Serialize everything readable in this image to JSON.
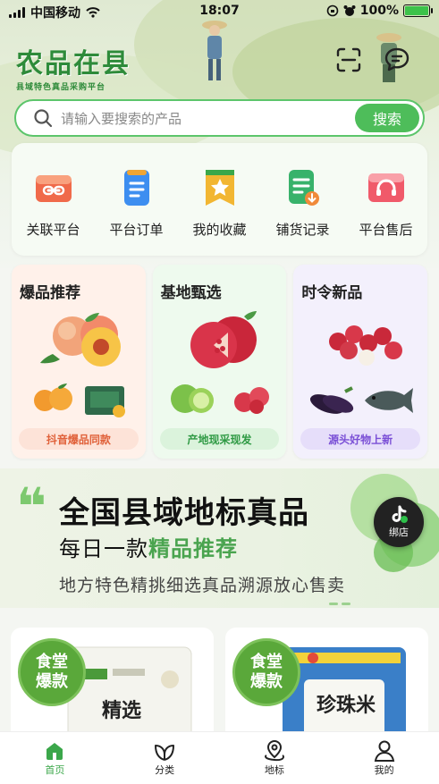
{
  "status": {
    "carrier": "中国移动",
    "time": "18:07",
    "battery": "100%"
  },
  "header": {
    "logo_title": "农品在县",
    "logo_subtitle": "县域特色真品采购平台"
  },
  "search": {
    "placeholder": "请输入要搜索的产品",
    "button": "搜索"
  },
  "quick_menu": [
    {
      "label": "关联平台",
      "icon": "link-icon",
      "color": "#f06a4a"
    },
    {
      "label": "平台订单",
      "icon": "order-icon",
      "color": "#3d8ef0"
    },
    {
      "label": "我的收藏",
      "icon": "star-icon",
      "color": "#f2b632"
    },
    {
      "label": "铺货记录",
      "icon": "record-icon",
      "color": "#38b26b"
    },
    {
      "label": "平台售后",
      "icon": "headset-icon",
      "color": "#f05a6a"
    }
  ],
  "feature_cards": [
    {
      "title": "爆品推荐",
      "tag": "抖音爆品同款",
      "bg": "#fff1ea",
      "tag_bg": "#fde3d8",
      "tag_color": "#e0613a"
    },
    {
      "title": "基地甄选",
      "tag": "产地现采现发",
      "bg": "#eefaee",
      "tag_bg": "#dbf3dc",
      "tag_color": "#2f9a44"
    },
    {
      "title": "时令新品",
      "tag": "源头好物上新",
      "bg": "#f3f0fc",
      "tag_bg": "#e6defa",
      "tag_color": "#7a4fd6"
    }
  ],
  "banner": {
    "line1": "全国县域地标真品",
    "line2_prefix": "每日一款",
    "line2_highlight": "精品推荐",
    "line3": "地方特色精挑细选真品溯源放心售卖"
  },
  "bind_button": {
    "label": "绑店"
  },
  "products": [
    {
      "badge": "食堂爆款",
      "pack_text": "精选"
    },
    {
      "badge": "食堂爆款",
      "pack_text": "珍珠米"
    }
  ],
  "tabbar": [
    {
      "label": "首页",
      "icon": "home-icon",
      "active": true
    },
    {
      "label": "分类",
      "icon": "leaf-icon",
      "active": false
    },
    {
      "label": "地标",
      "icon": "location-icon",
      "active": false
    },
    {
      "label": "我的",
      "icon": "user-icon",
      "active": false
    }
  ],
  "colors": {
    "accent": "#4ebd5a",
    "accent_dark": "#2e8b3a"
  }
}
